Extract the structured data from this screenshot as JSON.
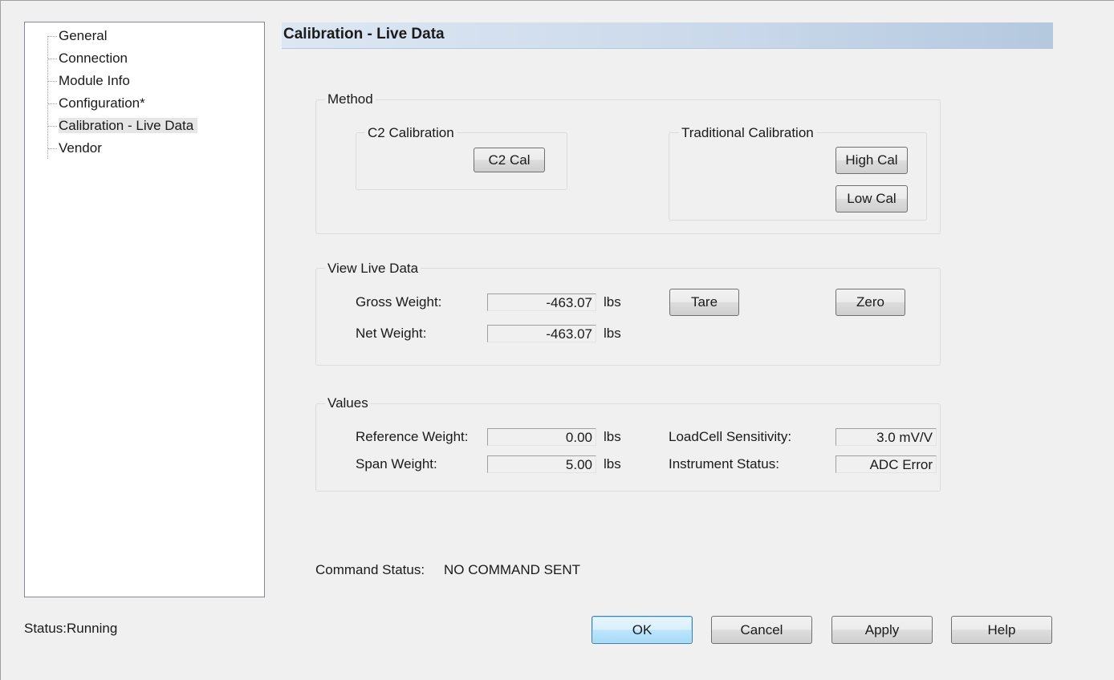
{
  "tree": {
    "items": [
      {
        "label": "General"
      },
      {
        "label": "Connection"
      },
      {
        "label": "Module Info"
      },
      {
        "label": "Configuration*"
      },
      {
        "label": "Calibration - Live Data"
      },
      {
        "label": "Vendor"
      }
    ]
  },
  "header": {
    "title": "Calibration - Live Data"
  },
  "method": {
    "label": "Method",
    "c2": {
      "label": "C2 Calibration",
      "button": "C2 Cal"
    },
    "traditional": {
      "label": "Traditional Calibration",
      "high_button": "High Cal",
      "low_button": "Low Cal"
    }
  },
  "live": {
    "label": "View Live Data",
    "gross_label": "Gross Weight:",
    "gross_value": "-463.07",
    "gross_unit": "lbs",
    "net_label": "Net Weight:",
    "net_value": "-463.07",
    "net_unit": "lbs",
    "tare_button": "Tare",
    "zero_button": "Zero"
  },
  "values": {
    "label": "Values",
    "ref_label": "Reference Weight:",
    "ref_value": "0.00",
    "ref_unit": "lbs",
    "span_label": "Span Weight:",
    "span_value": "5.00",
    "span_unit": "lbs",
    "sens_label": "LoadCell Sensitivity:",
    "sens_value": "3.0 mV/V",
    "status_label": "Instrument Status:",
    "status_value": "ADC Error"
  },
  "command": {
    "label": "Command Status:",
    "value": "NO COMMAND SENT"
  },
  "status": {
    "label": "Status:",
    "value": "Running"
  },
  "footer": {
    "ok": "OK",
    "cancel": "Cancel",
    "apply": "Apply",
    "help": "Help"
  },
  "colors": {
    "header_gradient_end": "#b4c8de",
    "default_button_border": "#3c7fb1",
    "tree_selection": "#e6e6e6"
  }
}
